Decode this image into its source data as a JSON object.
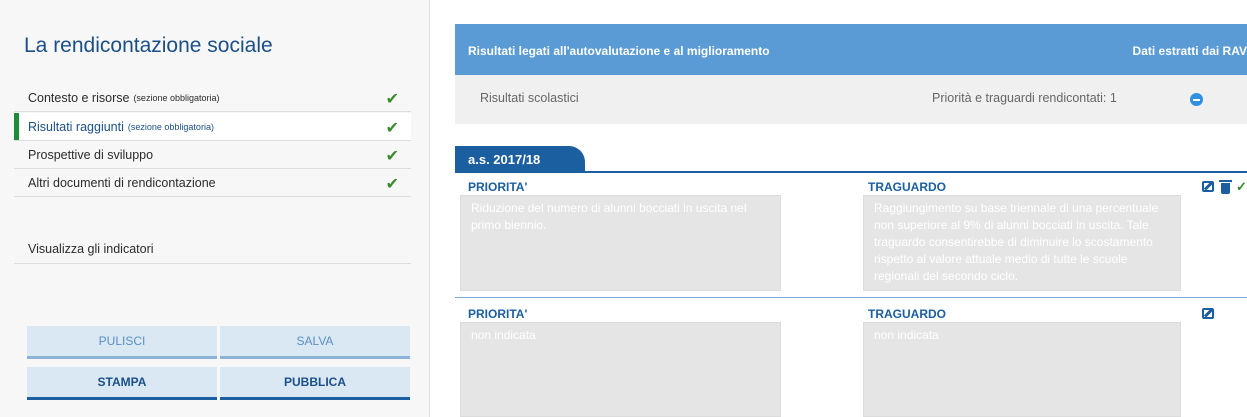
{
  "sidebar": {
    "title": "La rendicontazione sociale",
    "items": [
      {
        "label": "Contesto e risorse",
        "note": "(sezione obbligatoria)",
        "check": "✔"
      },
      {
        "label": "Risultati raggiunti",
        "note": "(sezione obbligatoria)",
        "check": "✔"
      },
      {
        "label": "Prospettive di sviluppo",
        "note": "",
        "check": "✔"
      },
      {
        "label": "Altri documenti di rendicontazione",
        "note": "",
        "check": "✔"
      }
    ],
    "indicators_label": "Visualizza gli indicatori",
    "buttons": {
      "clear": "PULISCI",
      "save": "SALVA",
      "print": "STAMPA",
      "publish": "PUBBLICA"
    }
  },
  "header": {
    "title": "Risultati legati all'autovalutazione e al miglioramento",
    "right": "Dati estratti dai RAV"
  },
  "summary": {
    "left": "Risultati scolastici",
    "right": "Priorità e traguardi rendicontati: 1"
  },
  "year_tab": "a.s. 2017/18",
  "rows": [
    {
      "priority_label": "PRIORITA'",
      "goal_label": "TRAGUARDO",
      "priority_text": "Riduzione del numero di alunni bocciati in uscita nel primo biennio.",
      "goal_text": "Raggiungimento su base triennale di una percentuale non superiore al 9% di alunni bocciati in uscita. Tale traguardo consentirebbe di diminuire lo scostamento rispetto al valore attuale medio di tutte le scuole regionali del secondo ciclo."
    },
    {
      "priority_label": "PRIORITA'",
      "goal_label": "TRAGUARDO",
      "priority_text": "non indicata",
      "goal_text": "non indicata"
    }
  ],
  "colors": {
    "brand_blue": "#1b5fa0",
    "header_blue": "#5a9bd5",
    "active_marker": "#1e8c3a",
    "check_green": "#3a8a2e"
  }
}
